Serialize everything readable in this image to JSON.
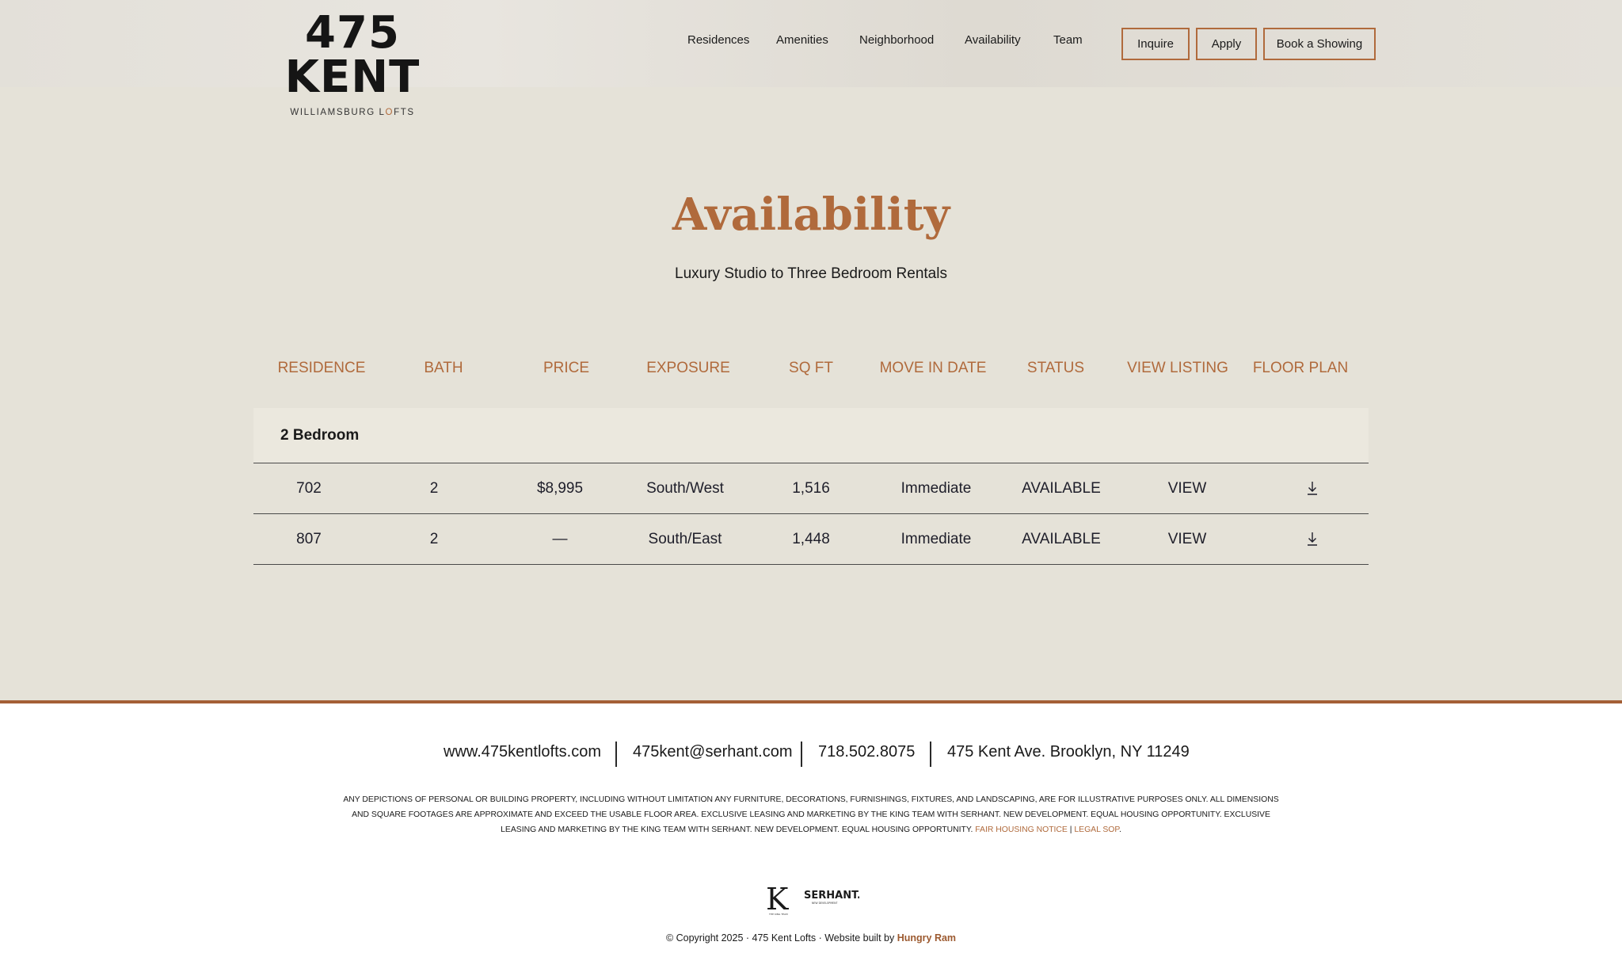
{
  "brand": {
    "logo_text": "475 KENT",
    "logo_sub_before": "WILLIAMSBURG L",
    "logo_sub_accent": "O",
    "logo_sub_after": "FTS"
  },
  "nav": {
    "items": [
      "Residences",
      "Amenities",
      "Neighborhood",
      "Availability",
      "Team"
    ]
  },
  "header_buttons": {
    "inquire": "Inquire",
    "apply": "Apply",
    "book": "Book a Showing"
  },
  "page": {
    "title": "Availability",
    "subtitle": "Luxury Studio to Three Bedroom Rentals"
  },
  "table": {
    "headers": [
      "RESIDENCE",
      "BATH",
      "PRICE",
      "EXPOSURE",
      "SQ FT",
      "MOVE IN DATE",
      "STATUS",
      "VIEW LISTING",
      "FLOOR PLAN"
    ],
    "group_label": "2 Bedroom",
    "rows": [
      {
        "residence": "702",
        "bath": "2",
        "price": "$8,995",
        "exposure": "South/West",
        "sqft": "1,516",
        "move_in": "Immediate",
        "status": "AVAILABLE",
        "view": "VIEW",
        "floor_plan_icon": "download-icon"
      },
      {
        "residence": "807",
        "bath": "2",
        "price": "—",
        "exposure": "South/East",
        "sqft": "1,448",
        "move_in": "Immediate",
        "status": "AVAILABLE",
        "view": "VIEW",
        "floor_plan_icon": "download-icon"
      }
    ]
  },
  "footer": {
    "website": "www.475kentlofts.com",
    "email": "475kent@serhant.com",
    "phone": "718.502.8075",
    "address": "475 Kent Ave. Brooklyn, NY 11249",
    "disclaimer": "ANY DEPICTIONS OF PERSONAL OR BUILDING PROPERTY, INCLUDING WITHOUT LIMITATION ANY FURNITURE, DECORATIONS, FURNISHINGS, FIXTURES, AND LANDSCAPING, ARE FOR ILLUSTRATIVE PURPOSES ONLY. ALL DIMENSIONS AND SQUARE FOOTAGES ARE APPROXIMATE AND EXCEED THE USABLE FLOOR AREA. EXCLUSIVE LEASING AND MARKETING BY THE KING TEAM WITH SERHANT. NEW DEVELOPMENT. EQUAL HOUSING OPPORTUNITY. EXCLUSIVE LEASING AND MARKETING BY THE KING TEAM WITH SERHANT. NEW DEVELOPMENT. EQUAL HOUSING OPPORTUNITY.",
    "fair_housing_link": "FAIR HOUSING NOTICE",
    "link_separator": "|",
    "legal_sop_link": "LEGAL SOP",
    "disclaimer_end": ".",
    "partner_logo_k": "K",
    "partner_logo_k_sub": "THE KING TEAM",
    "partner_logo_serhant": "SERHANT.",
    "partner_logo_serhant_sub": "NEW DEVELOPMENT",
    "copyright_prefix": "© Copyright 2025 · 475 Kent Lofts · Website built by",
    "builder_link": "Hungry Ram"
  },
  "colors": {
    "accent": "#b06a3c",
    "background": "#e5e2d8",
    "group_row_bg": "#ebe8de",
    "footer_border": "#a45f36"
  }
}
